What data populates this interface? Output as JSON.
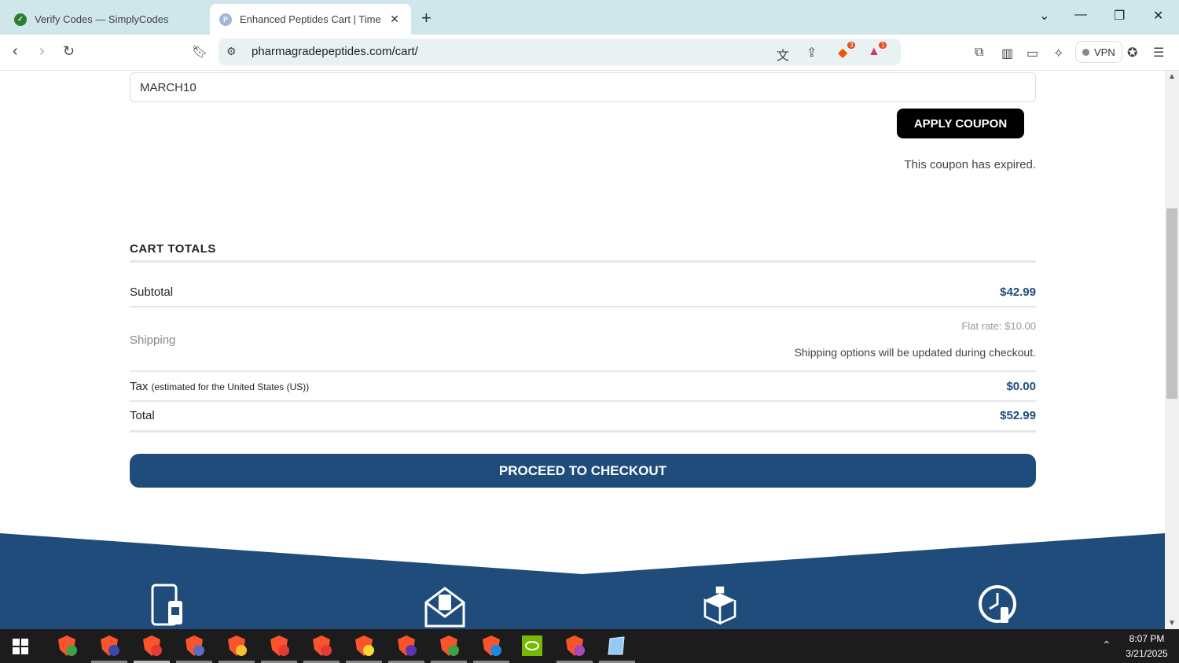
{
  "browser": {
    "tabs": [
      {
        "title": "Verify Codes — SimplyCodes",
        "active": false
      },
      {
        "title": "Enhanced Peptides Cart | Time",
        "active": true
      }
    ],
    "url": "pharmagradepeptides.com/cart/",
    "shield_badge": "3",
    "alert_badge": "1",
    "vpn_label": "VPN"
  },
  "coupon": {
    "input_value": "MARCH10",
    "apply_label": "APPLY COUPON",
    "message": "This coupon has expired."
  },
  "cart_totals": {
    "title": "CART TOTALS",
    "subtotal_label": "Subtotal",
    "subtotal_value": "$42.99",
    "shipping_label": "Shipping",
    "shipping_rate": "Flat rate: $10.00",
    "shipping_note": "Shipping options will be updated during checkout.",
    "tax_label": "Tax",
    "tax_note": "(estimated for the United States (US))",
    "tax_value": "$0.00",
    "total_label": "Total",
    "total_value": "$52.99"
  },
  "checkout": {
    "label": "PROCEED TO CHECKOUT"
  },
  "taskbar": {
    "time": "8:07 PM",
    "date": "3/21/2025"
  },
  "colors": {
    "brand_blue": "#1f4c7a",
    "tabbar": "#cfe6eb"
  }
}
